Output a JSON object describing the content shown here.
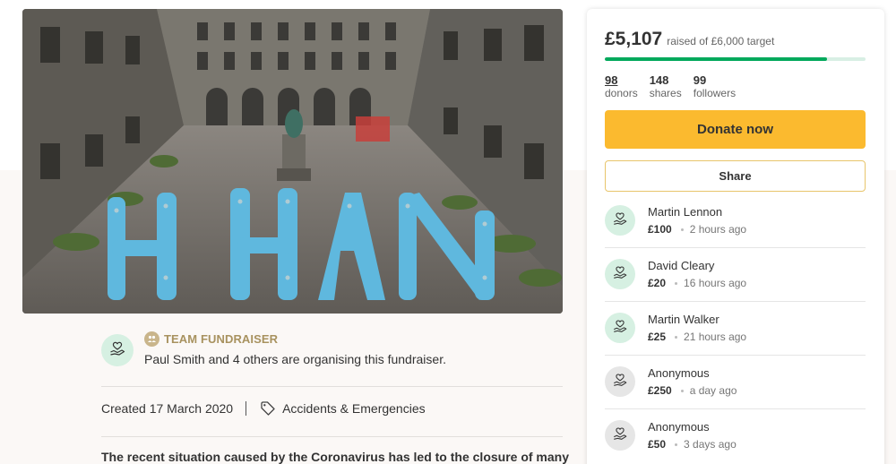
{
  "hero": {
    "alt": "Group of people in blue forming letters in a courtyard"
  },
  "organiser": {
    "team_label": "TEAM FUNDRAISER",
    "text": "Paul Smith and 4 others are organising this fundraiser."
  },
  "meta": {
    "created": "Created 17 March 2020",
    "category": "Accidents & Emergencies"
  },
  "story": {
    "first_line": "The recent situation caused by the Coronavirus has led to the closure of many"
  },
  "campaign": {
    "raised": "£5,107",
    "target_text": "raised of £6,000 target",
    "progress_fraction": 0.851,
    "donors_count": "98",
    "donors_label": "donors",
    "shares_count": "148",
    "shares_label": "shares",
    "followers_count": "99",
    "followers_label": "followers",
    "donate_label": "Donate now",
    "share_label": "Share"
  },
  "donations": [
    {
      "name": "Martin Lennon",
      "amount": "£100",
      "time": "2 hours ago",
      "avatar": "green"
    },
    {
      "name": "David Cleary",
      "amount": "£20",
      "time": "16 hours ago",
      "avatar": "green"
    },
    {
      "name": "Martin Walker",
      "amount": "£25",
      "time": "21 hours ago",
      "avatar": "green"
    },
    {
      "name": "Anonymous",
      "amount": "£250",
      "time": "a day ago",
      "avatar": "grey"
    },
    {
      "name": "Anonymous",
      "amount": "£50",
      "time": "3 days ago",
      "avatar": "grey"
    }
  ],
  "colors": {
    "accent_green": "#02a95c",
    "donate_yellow": "#fbba2f",
    "team_gold": "#a8925f"
  },
  "icons": {
    "organiser_avatar": "heart-hand-icon",
    "team": "team-icon",
    "category": "tag-icon",
    "donor_avatar": "heart-hand-icon"
  }
}
